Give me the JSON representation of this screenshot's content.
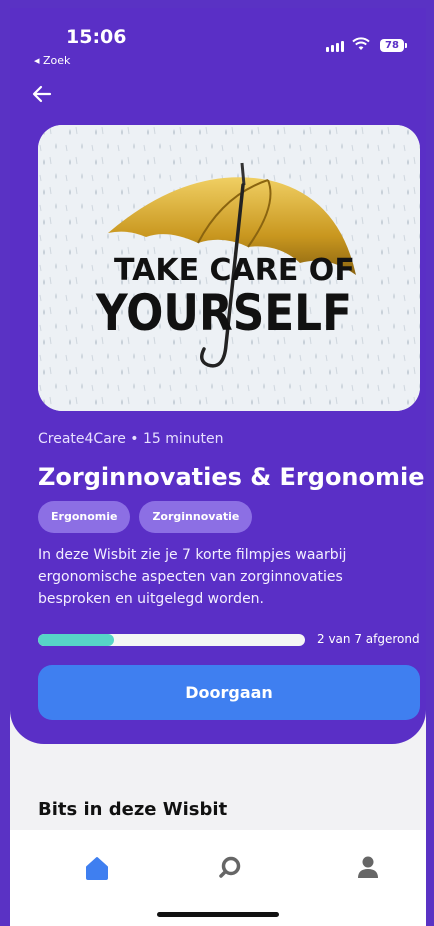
{
  "status_bar": {
    "time": "15:06",
    "back_app": "◂ Zoek",
    "battery": "78"
  },
  "header": {
    "back_icon": "arrow-left-icon"
  },
  "cover_image": {
    "line1": "TAKE CARE OF",
    "line2": "YOURSELF"
  },
  "wisbit": {
    "meta": "Create4Care • 15 minuten",
    "title": "Zorginnovaties & Ergonomie",
    "tags": [
      "Ergonomie",
      "Zorginnovatie"
    ],
    "description": "In deze Wisbit zie je 7 korte filmpjes waarbij ergonomische aspecten van zorginnovaties besproken en uitgelegd worden.",
    "progress": {
      "done": 2,
      "total": 7,
      "text": "2 van 7 afgerond"
    },
    "cta": "Doorgaan"
  },
  "section": {
    "title": "Bits in deze Wisbit"
  },
  "tabbar": {
    "items": [
      "home-icon",
      "search-icon",
      "profile-icon"
    ]
  },
  "colors": {
    "primary": "#5a2fc6",
    "accent": "#3f7ff0",
    "progress": "#57d4c7"
  }
}
